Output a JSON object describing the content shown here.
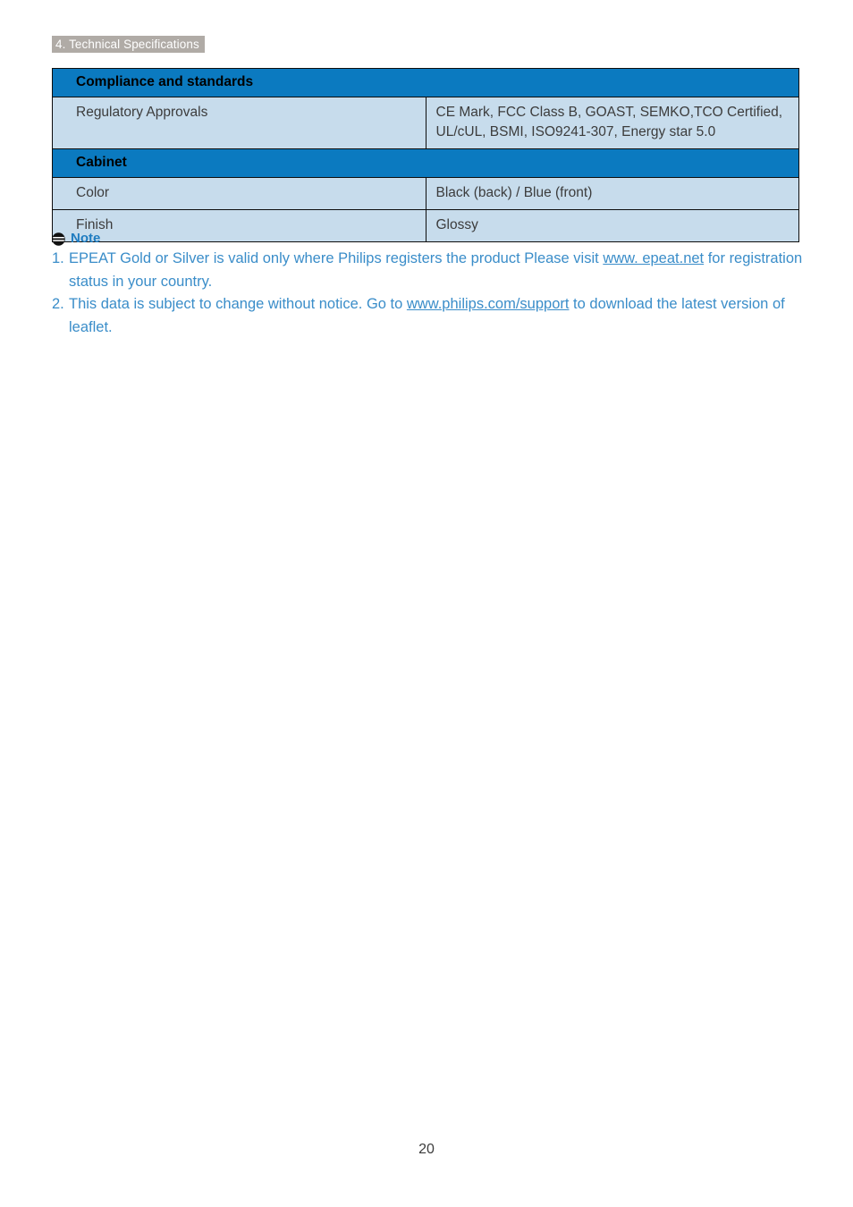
{
  "header": {
    "breadcrumb": "4. Technical Specifications"
  },
  "colors": {
    "section_header_bg": "#0b7ac0",
    "row_bg": "#c7dcec",
    "breadcrumb_bg": "#b0aba6",
    "note_text": "#3a8dc9",
    "note_title": "#1f7cc0",
    "border": "#0d0d0d"
  },
  "table": {
    "sections": [
      {
        "title": "Compliance and standards",
        "rows": [
          {
            "label": "Regulatory Approvals",
            "value": "CE Mark, FCC Class B, GOAST, SEMKO,TCO Certified, UL/cUL, BSMI, ISO9241-307, Energy star 5.0"
          }
        ]
      },
      {
        "title": "Cabinet",
        "rows": [
          {
            "label": "Color",
            "value": "Black (back) / Blue (front)"
          },
          {
            "label": "Finish",
            "value": "Glossy"
          }
        ]
      }
    ]
  },
  "note": {
    "icon": "note-circle-icon",
    "title": "Note",
    "items": [
      {
        "number": "1.",
        "text_before": "EPEAT Gold or Silver is valid only where Philips registers the product Please visit ",
        "link": "www. epeat.net",
        "text_after": " for registration status in your country."
      },
      {
        "number": "2.",
        "text_before": "This data is subject to change without notice. Go to ",
        "link": "www.philips.com/support",
        "text_after": " to download the latest version of leaflet."
      }
    ]
  },
  "footer": {
    "page_number": "20"
  }
}
